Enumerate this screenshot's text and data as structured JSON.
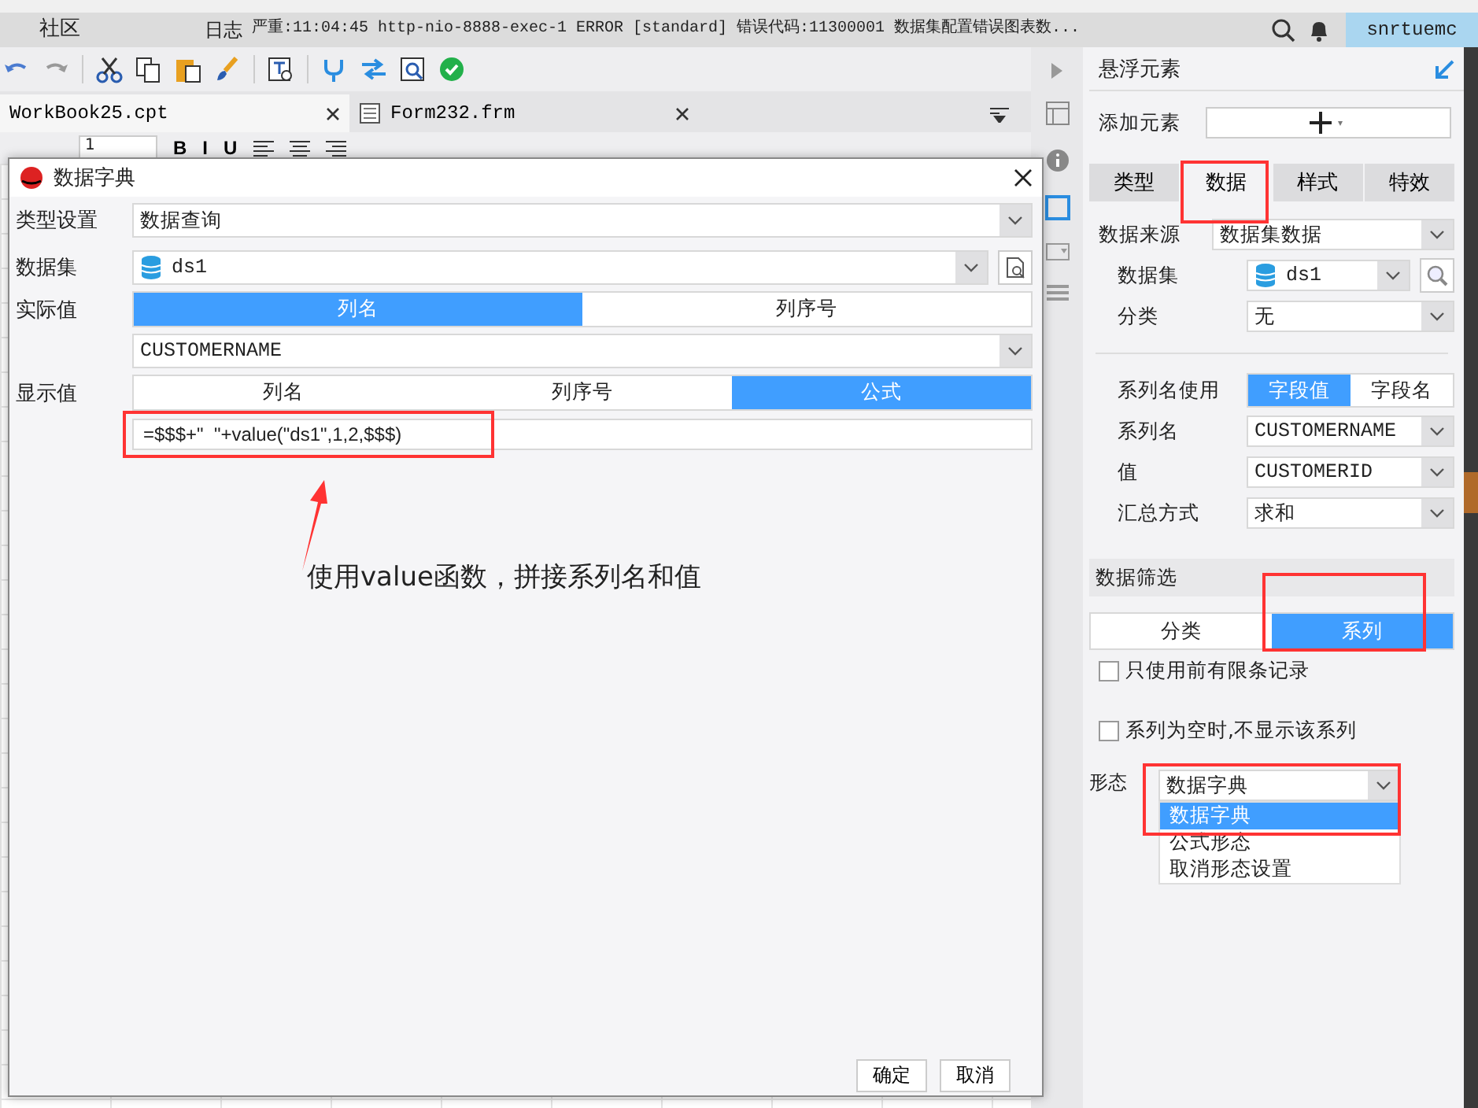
{
  "top_bar": {
    "community": "社区",
    "log_label": "日志",
    "log_message": "严重:11:04:45 http-nio-8888-exec-1 ERROR [standard] 错误代码:11300001 数据集配置错误图表数...",
    "user": "snrtuemc"
  },
  "file_tabs": [
    {
      "label": "WorkBook25.cpt",
      "selected": true
    },
    {
      "label": "Form232.frm",
      "selected": false
    }
  ],
  "format_bar": {
    "font_size": "1",
    "styles": [
      "B",
      "I",
      "U"
    ]
  },
  "dialog": {
    "title": "数据字典",
    "type_label": "类型设置",
    "type_value": "数据查询",
    "dataset_label": "数据集",
    "dataset_value": "ds1",
    "actual_label": "实际值",
    "actual_options": [
      {
        "label": "列名",
        "selected": true
      },
      {
        "label": "列序号",
        "selected": false
      }
    ],
    "actual_column": "CUSTOMERNAME",
    "display_label": "显示值",
    "display_options": [
      {
        "label": "列名",
        "selected": false
      },
      {
        "label": "列序号",
        "selected": false
      },
      {
        "label": "公式",
        "selected": true
      }
    ],
    "formula": {
      "value": "=$$$+\"  \"+value(\"ds1\",1,2,$$$)",
      "highlighted": true
    },
    "annotation": "使用value函数，拼接系列名和值",
    "buttons": [
      "确定",
      "取消"
    ]
  },
  "panel": {
    "title": "悬浮元素",
    "add_label": "添加元素",
    "tabs": [
      {
        "label": "类型",
        "selected": false,
        "highlighted": false
      },
      {
        "label": "数据",
        "selected": true,
        "highlighted": true
      },
      {
        "label": "样式",
        "selected": false,
        "highlighted": false
      },
      {
        "label": "特效",
        "selected": false,
        "highlighted": false
      }
    ],
    "source": {
      "label": "数据来源",
      "value": "数据集数据"
    },
    "dataset": {
      "label": "数据集",
      "value": "ds1"
    },
    "category": {
      "label": "分类",
      "value": "无"
    },
    "series_name_use": {
      "label": "系列名使用",
      "options": [
        {
          "label": "字段值",
          "selected": true
        },
        {
          "label": "字段名",
          "selected": false
        }
      ]
    },
    "series_name": {
      "label": "系列名",
      "value": "CUSTOMERNAME"
    },
    "value": {
      "label": "值",
      "value": "CUSTOMERID"
    },
    "summary": {
      "label": "汇总方式",
      "value": "求和"
    },
    "filter": {
      "title": "数据筛选",
      "options": [
        {
          "label": "分类",
          "selected": false,
          "highlighted": false
        },
        {
          "label": "系列",
          "selected": true,
          "highlighted": true
        }
      ],
      "checkboxes": [
        {
          "label": "只使用前有限条记录",
          "checked": false
        },
        {
          "label": "系列为空时,不显示该系列",
          "checked": false
        }
      ]
    },
    "form": {
      "label": "形态",
      "value": "数据字典",
      "highlighted": true,
      "options": [
        {
          "label": "数据字典",
          "selected": true
        },
        {
          "label": "公式形态",
          "selected": false
        },
        {
          "label": "取消形态设置",
          "selected": false
        }
      ]
    }
  }
}
